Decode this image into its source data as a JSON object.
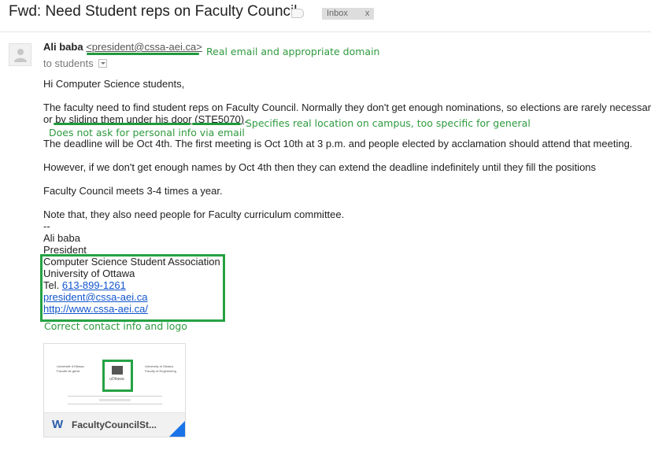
{
  "header": {
    "subject": "Fwd: Need Student reps on Faculty Council",
    "label": "Inbox",
    "label_close": "x"
  },
  "message": {
    "sender_name": "Ali baba",
    "sender_email": "<president@cssa-aei.ca>",
    "to_line": "to students",
    "greeting": "Hi Computer Science students,",
    "para1_line1": "The faculty need to find student reps on Faculty Council. Normally they don't get enough nominations, so elections are rarely necessary.",
    "para1_or": "or",
    "para1_link": "by sliding them under his door",
    "para1_room": "(STE5070)",
    "para1_end": ".",
    "para2": "The deadline will be Oct 4th. The first meeting is Oct 10th at 3 p.m. and people elected by acclamation should attend that meeting.",
    "para3": "However, if we don't get enough names by Oct 4th then they can extend the deadline indefinitely until they fill the positions",
    "para4": "Faculty Council meets 3-4 times a year.",
    "para5": "Note that, they also need people for Faculty curriculum committee.",
    "sig_dash": "--",
    "sig_name": "Ali baba",
    "sig_title": "President",
    "sig_org": "Computer Science Student Association",
    "sig_univ": "University of Ottawa",
    "sig_tel_prefix": "Tel.",
    "sig_tel": "613-899-1261",
    "sig_email": "president@cssa-aei.ca",
    "sig_url": "http://www.cssa-aei.ca/"
  },
  "annotations": {
    "email_note": "Real email and appropriate domain",
    "location_note": "Specifies real location on campus, too specific for general",
    "personal_info_note": "Does not ask for personal info via email",
    "contact_note": "Correct contact info and logo"
  },
  "attachment": {
    "icon_letter": "W",
    "file_name": "FacultyCouncilSt...",
    "doc_left_1": "Université d'Ottawa",
    "doc_left_2": "Faculté de génie",
    "doc_right_1": "University of Ottawa",
    "doc_right_2": "Faculty of Engineering",
    "doc_logo_text": "uOttawa"
  },
  "colors": {
    "annotation_green": "#2f9a3f",
    "box_green": "#25a244",
    "link_blue": "#1155cc"
  }
}
